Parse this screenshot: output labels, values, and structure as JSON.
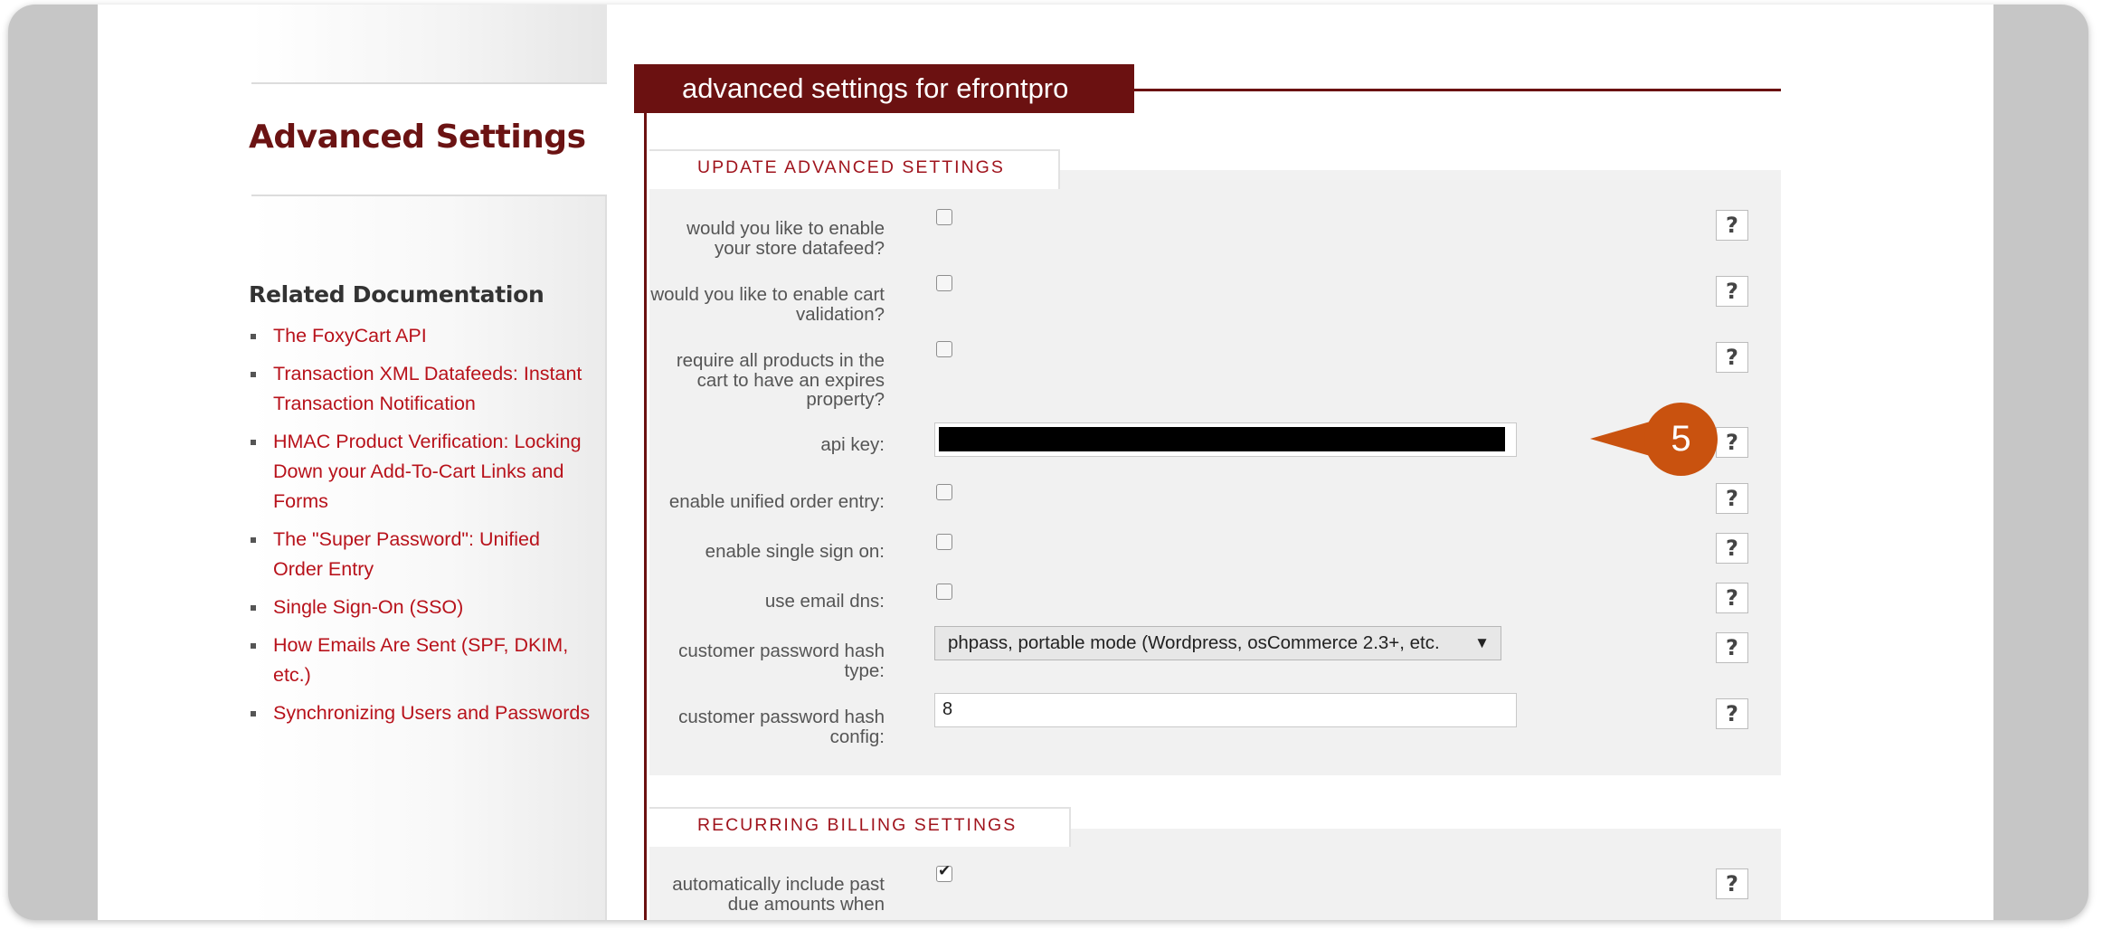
{
  "sidebar": {
    "heading": "Advanced Settings",
    "related_heading": "Related Documentation",
    "docs": [
      {
        "label": "The FoxyCart API"
      },
      {
        "label": "Transaction XML Datafeeds: Instant Transaction Notification"
      },
      {
        "label": "HMAC Product Verification: Locking Down your Add-To-Cart Links and Forms"
      },
      {
        "label": "The \"Super Password\": Unified Order Entry"
      },
      {
        "label": "Single Sign-On (SSO)"
      },
      {
        "label": "How Emails Are Sent (SPF, DKIM, etc.)"
      },
      {
        "label": "Synchronizing Users and Passwords"
      }
    ]
  },
  "main": {
    "title": "advanced settings for efrontpro",
    "section_update": "UPDATE ADVANCED SETTINGS",
    "section_recurring": "RECURRING BILLING SETTINGS",
    "help_label": "?",
    "fields": {
      "datafeed_label": "would you like to enable your store datafeed?",
      "datafeed_checked": false,
      "cart_validation_label": "would you like to enable cart validation?",
      "cart_validation_checked": false,
      "expires_label": "require all products in the cart to have an expires property?",
      "expires_checked": false,
      "api_key_label": "api key:",
      "unified_order_label": "enable unified order entry:",
      "unified_order_checked": false,
      "sso_label": "enable single sign on:",
      "sso_checked": false,
      "email_dns_label": "use email dns:",
      "email_dns_checked": false,
      "hash_type_label": "customer password hash type:",
      "hash_type_value": "phpass, portable mode (Wordpress, osCommerce 2.3+, etc.",
      "hash_config_label": "customer password hash config:",
      "hash_config_value": "8",
      "past_due_label": "automatically include past due amounts when",
      "past_due_checked": true
    }
  },
  "callout": {
    "number": "5",
    "color": "#c9520f"
  },
  "colors": {
    "brand": "#6b1111",
    "link": "#b8121b"
  }
}
